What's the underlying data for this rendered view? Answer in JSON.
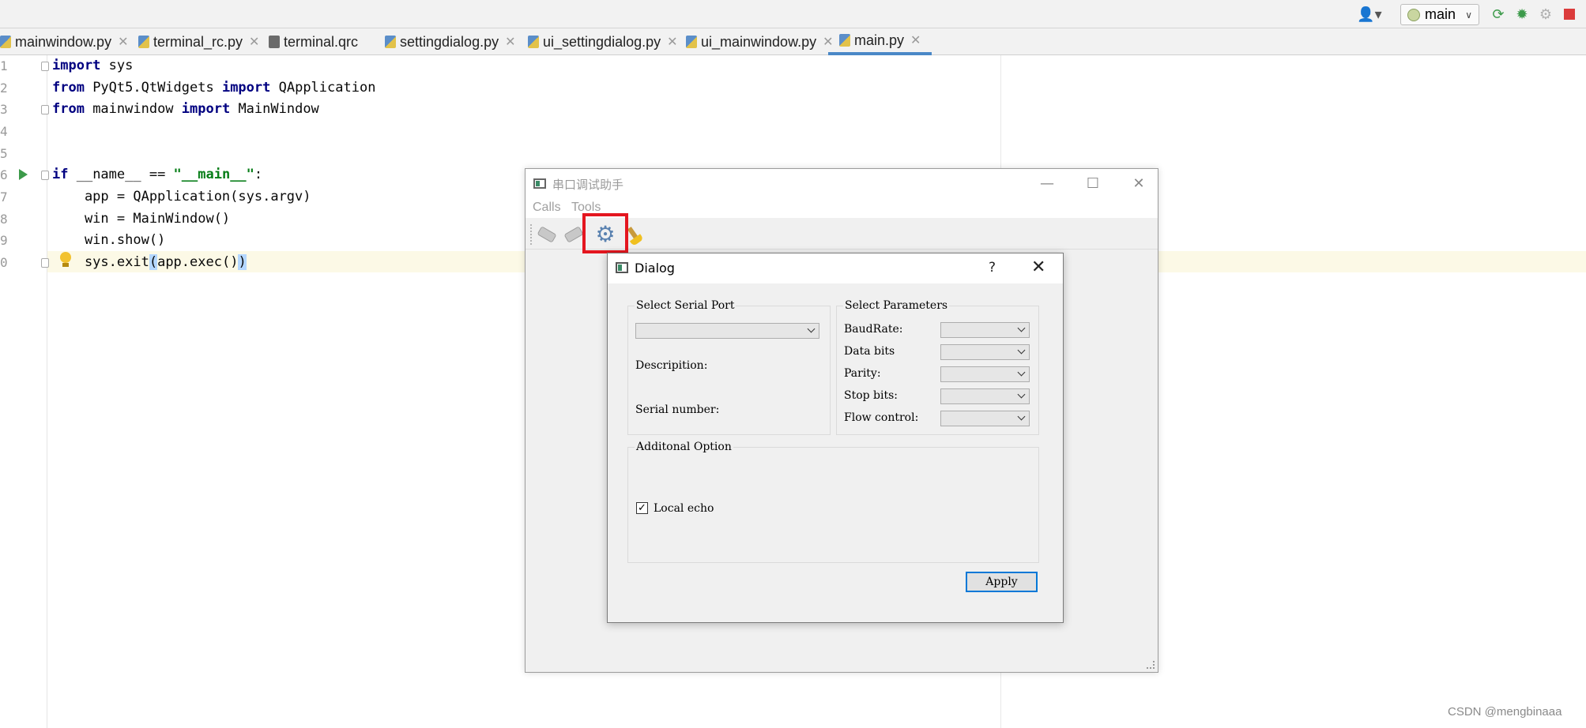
{
  "ide": {
    "run_config": "main",
    "tabs": [
      {
        "label": "mainwindow.py",
        "type": "py"
      },
      {
        "label": "terminal_rc.py",
        "type": "py"
      },
      {
        "label": "terminal.qrc",
        "type": "qrc"
      },
      {
        "label": "settingdialog.py",
        "type": "py"
      },
      {
        "label": "ui_settingdialog.py",
        "type": "py"
      },
      {
        "label": "ui_mainwindow.py",
        "type": "py"
      },
      {
        "label": "main.py",
        "type": "py",
        "active": true
      }
    ],
    "line_numbers": [
      "1",
      "2",
      "3",
      "4",
      "5",
      "6",
      "7",
      "8",
      "9",
      "0"
    ],
    "code": {
      "l1_kw": "import",
      "l1_rest": " sys",
      "l2_kw1": "from",
      "l2_mid": " PyQt5.QtWidgets ",
      "l2_kw2": "import",
      "l2_rest": " QApplication",
      "l3_kw1": "from",
      "l3_mid": " mainwindow ",
      "l3_kw2": "import",
      "l3_rest": " MainWindow",
      "l6_kw": "if",
      "l6_mid": " __name__ == ",
      "l6_str": "\"__main__\"",
      "l6_end": ":",
      "l7": "    app = QApplication(sys.argv)",
      "l8": "    win = MainWindow()",
      "l9": "    win.show()",
      "l10_a": "    sys.exit",
      "l10_b": "(",
      "l10_c": "app.exec()",
      "l10_d": ")"
    }
  },
  "app_window": {
    "title": "串口调试助手",
    "menu": [
      "Calls",
      "Tools"
    ]
  },
  "dialog": {
    "title": "Dialog",
    "help": "?",
    "close": "✕",
    "serial_group": {
      "title": "Select Serial Port",
      "port_value": "",
      "description_label": "Descripition:",
      "serial_number_label": "Serial number:"
    },
    "params_group": {
      "title": "Select Parameters",
      "fields": [
        {
          "label": "BaudRate:",
          "value": ""
        },
        {
          "label": "Data bits",
          "value": ""
        },
        {
          "label": "Parity:",
          "value": ""
        },
        {
          "label": "Stop bits:",
          "value": ""
        },
        {
          "label": "Flow control:",
          "value": ""
        }
      ]
    },
    "additional_group": {
      "title": "Additonal Option",
      "local_echo_label": "Local echo",
      "local_echo_checked": true
    },
    "apply_label": "Apply"
  },
  "watermark": "CSDN @mengbinaaa",
  "colors": {
    "highlight": "#e4161f",
    "focus_blue": "#0078d7",
    "keyword": "#000080",
    "string": "#067d17"
  }
}
